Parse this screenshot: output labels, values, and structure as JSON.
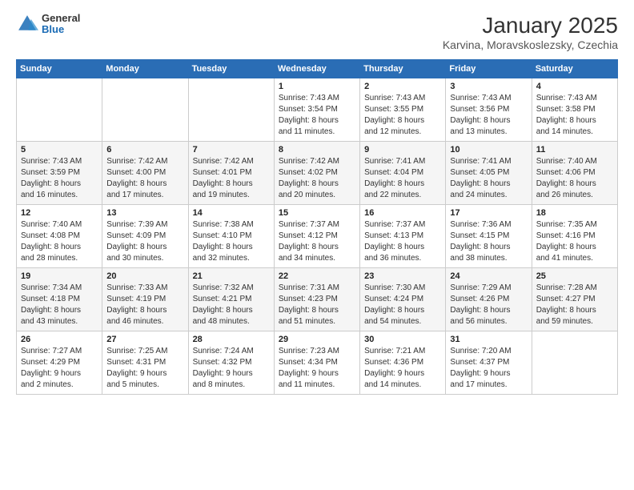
{
  "header": {
    "logo_general": "General",
    "logo_blue": "Blue",
    "month_title": "January 2025",
    "location": "Karvina, Moravskoslezsky, Czechia"
  },
  "days_of_week": [
    "Sunday",
    "Monday",
    "Tuesday",
    "Wednesday",
    "Thursday",
    "Friday",
    "Saturday"
  ],
  "weeks": [
    [
      {
        "day": "",
        "info": ""
      },
      {
        "day": "",
        "info": ""
      },
      {
        "day": "",
        "info": ""
      },
      {
        "day": "1",
        "info": "Sunrise: 7:43 AM\nSunset: 3:54 PM\nDaylight: 8 hours\nand 11 minutes."
      },
      {
        "day": "2",
        "info": "Sunrise: 7:43 AM\nSunset: 3:55 PM\nDaylight: 8 hours\nand 12 minutes."
      },
      {
        "day": "3",
        "info": "Sunrise: 7:43 AM\nSunset: 3:56 PM\nDaylight: 8 hours\nand 13 minutes."
      },
      {
        "day": "4",
        "info": "Sunrise: 7:43 AM\nSunset: 3:58 PM\nDaylight: 8 hours\nand 14 minutes."
      }
    ],
    [
      {
        "day": "5",
        "info": "Sunrise: 7:43 AM\nSunset: 3:59 PM\nDaylight: 8 hours\nand 16 minutes."
      },
      {
        "day": "6",
        "info": "Sunrise: 7:42 AM\nSunset: 4:00 PM\nDaylight: 8 hours\nand 17 minutes."
      },
      {
        "day": "7",
        "info": "Sunrise: 7:42 AM\nSunset: 4:01 PM\nDaylight: 8 hours\nand 19 minutes."
      },
      {
        "day": "8",
        "info": "Sunrise: 7:42 AM\nSunset: 4:02 PM\nDaylight: 8 hours\nand 20 minutes."
      },
      {
        "day": "9",
        "info": "Sunrise: 7:41 AM\nSunset: 4:04 PM\nDaylight: 8 hours\nand 22 minutes."
      },
      {
        "day": "10",
        "info": "Sunrise: 7:41 AM\nSunset: 4:05 PM\nDaylight: 8 hours\nand 24 minutes."
      },
      {
        "day": "11",
        "info": "Sunrise: 7:40 AM\nSunset: 4:06 PM\nDaylight: 8 hours\nand 26 minutes."
      }
    ],
    [
      {
        "day": "12",
        "info": "Sunrise: 7:40 AM\nSunset: 4:08 PM\nDaylight: 8 hours\nand 28 minutes."
      },
      {
        "day": "13",
        "info": "Sunrise: 7:39 AM\nSunset: 4:09 PM\nDaylight: 8 hours\nand 30 minutes."
      },
      {
        "day": "14",
        "info": "Sunrise: 7:38 AM\nSunset: 4:10 PM\nDaylight: 8 hours\nand 32 minutes."
      },
      {
        "day": "15",
        "info": "Sunrise: 7:37 AM\nSunset: 4:12 PM\nDaylight: 8 hours\nand 34 minutes."
      },
      {
        "day": "16",
        "info": "Sunrise: 7:37 AM\nSunset: 4:13 PM\nDaylight: 8 hours\nand 36 minutes."
      },
      {
        "day": "17",
        "info": "Sunrise: 7:36 AM\nSunset: 4:15 PM\nDaylight: 8 hours\nand 38 minutes."
      },
      {
        "day": "18",
        "info": "Sunrise: 7:35 AM\nSunset: 4:16 PM\nDaylight: 8 hours\nand 41 minutes."
      }
    ],
    [
      {
        "day": "19",
        "info": "Sunrise: 7:34 AM\nSunset: 4:18 PM\nDaylight: 8 hours\nand 43 minutes."
      },
      {
        "day": "20",
        "info": "Sunrise: 7:33 AM\nSunset: 4:19 PM\nDaylight: 8 hours\nand 46 minutes."
      },
      {
        "day": "21",
        "info": "Sunrise: 7:32 AM\nSunset: 4:21 PM\nDaylight: 8 hours\nand 48 minutes."
      },
      {
        "day": "22",
        "info": "Sunrise: 7:31 AM\nSunset: 4:23 PM\nDaylight: 8 hours\nand 51 minutes."
      },
      {
        "day": "23",
        "info": "Sunrise: 7:30 AM\nSunset: 4:24 PM\nDaylight: 8 hours\nand 54 minutes."
      },
      {
        "day": "24",
        "info": "Sunrise: 7:29 AM\nSunset: 4:26 PM\nDaylight: 8 hours\nand 56 minutes."
      },
      {
        "day": "25",
        "info": "Sunrise: 7:28 AM\nSunset: 4:27 PM\nDaylight: 8 hours\nand 59 minutes."
      }
    ],
    [
      {
        "day": "26",
        "info": "Sunrise: 7:27 AM\nSunset: 4:29 PM\nDaylight: 9 hours\nand 2 minutes."
      },
      {
        "day": "27",
        "info": "Sunrise: 7:25 AM\nSunset: 4:31 PM\nDaylight: 9 hours\nand 5 minutes."
      },
      {
        "day": "28",
        "info": "Sunrise: 7:24 AM\nSunset: 4:32 PM\nDaylight: 9 hours\nand 8 minutes."
      },
      {
        "day": "29",
        "info": "Sunrise: 7:23 AM\nSunset: 4:34 PM\nDaylight: 9 hours\nand 11 minutes."
      },
      {
        "day": "30",
        "info": "Sunrise: 7:21 AM\nSunset: 4:36 PM\nDaylight: 9 hours\nand 14 minutes."
      },
      {
        "day": "31",
        "info": "Sunrise: 7:20 AM\nSunset: 4:37 PM\nDaylight: 9 hours\nand 17 minutes."
      },
      {
        "day": "",
        "info": ""
      }
    ]
  ]
}
